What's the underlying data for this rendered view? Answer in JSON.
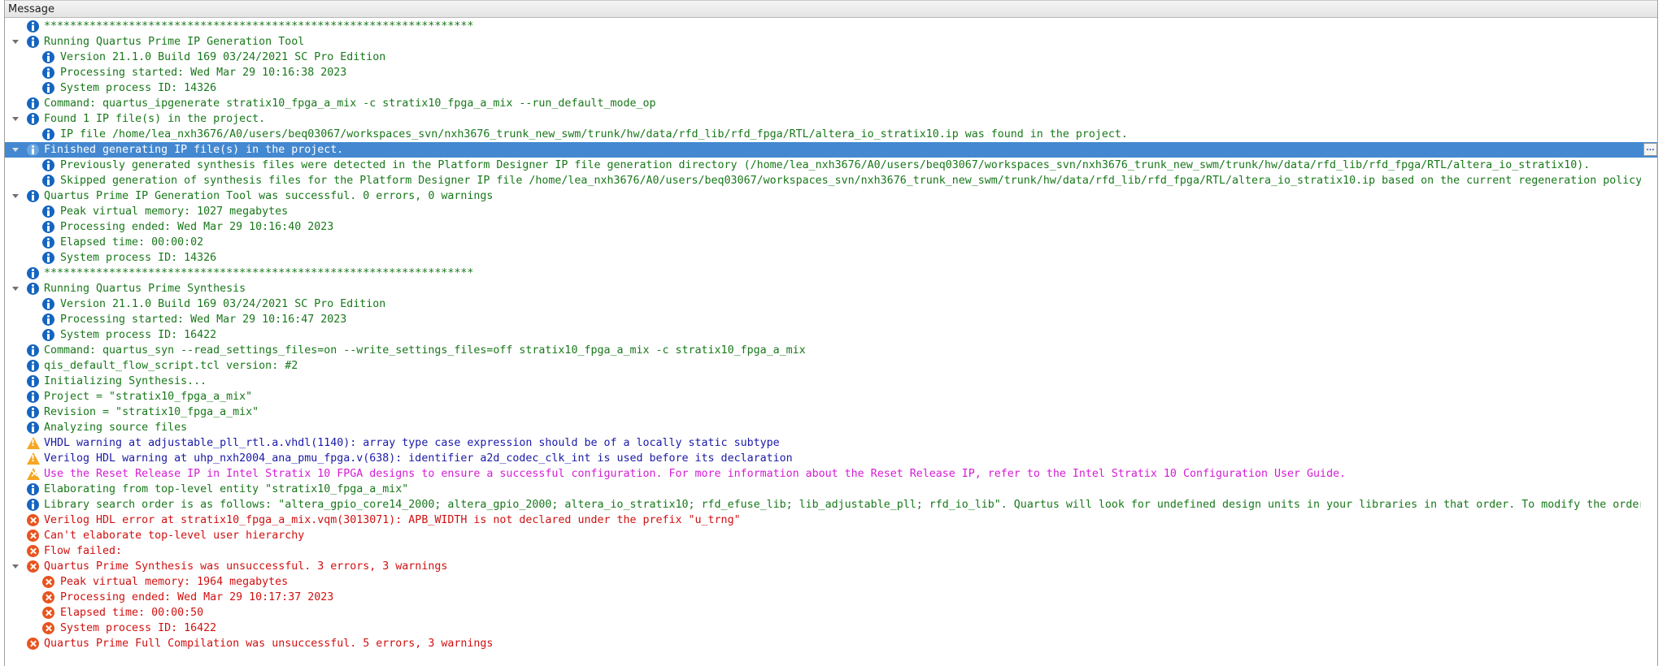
{
  "header": {
    "column": "Message"
  },
  "colors": {
    "info_text": "#18781a",
    "warning_text": "#1a1aa8",
    "critical_warning_text": "#d41cd4",
    "error_text": "#d01010",
    "selection": "#4388d0"
  },
  "rows": [
    {
      "level": 0,
      "expand": false,
      "type": "info",
      "text": "******************************************************************"
    },
    {
      "level": 0,
      "expand": true,
      "type": "info",
      "text": "Running Quartus Prime IP Generation Tool"
    },
    {
      "level": 1,
      "expand": false,
      "type": "info",
      "text": "Version 21.1.0 Build 169 03/24/2021 SC Pro Edition"
    },
    {
      "level": 1,
      "expand": false,
      "type": "info",
      "text": "Processing started: Wed Mar 29 10:16:38 2023"
    },
    {
      "level": 1,
      "expand": false,
      "type": "info",
      "text": "System process ID: 14326"
    },
    {
      "level": 0,
      "expand": false,
      "type": "info",
      "text": "Command: quartus_ipgenerate stratix10_fpga_a_mix -c stratix10_fpga_a_mix --run_default_mode_op"
    },
    {
      "level": 0,
      "expand": true,
      "type": "info",
      "text": "Found 1 IP file(s) in the project."
    },
    {
      "level": 1,
      "expand": false,
      "type": "info",
      "text": "IP file /home/lea_nxh3676/A0/users/beq03067/workspaces_svn/nxh3676_trunk_new_swm/trunk/hw/data/rfd_lib/rfd_fpga/RTL/altera_io_stratix10.ip was found in the project."
    },
    {
      "level": 0,
      "expand": true,
      "type": "info",
      "selected": true,
      "text": "Finished generating IP file(s) in the project.",
      "more": "..."
    },
    {
      "level": 1,
      "expand": false,
      "type": "info",
      "text": "Previously generated synthesis files were detected in the Platform Designer IP file generation directory (/home/lea_nxh3676/A0/users/beq03067/workspaces_svn/nxh3676_trunk_new_swm/trunk/hw/data/rfd_lib/rfd_fpga/RTL/altera_io_stratix10)."
    },
    {
      "level": 1,
      "expand": false,
      "type": "info",
      "text": "Skipped generation of synthesis files for the Platform Designer IP file /home/lea_nxh3676/A0/users/beq03067/workspaces_svn/nxh3676_trunk_new_swm/trunk/hw/data/rfd_lib/rfd_fpga/RTL/altera_io_stratix10.ip based on the current regeneration policy…"
    },
    {
      "level": 0,
      "expand": true,
      "type": "info",
      "text": "Quartus Prime IP Generation Tool was successful. 0 errors, 0 warnings"
    },
    {
      "level": 1,
      "expand": false,
      "type": "info",
      "text": "Peak virtual memory: 1027 megabytes"
    },
    {
      "level": 1,
      "expand": false,
      "type": "info",
      "text": "Processing ended: Wed Mar 29 10:16:40 2023"
    },
    {
      "level": 1,
      "expand": false,
      "type": "info",
      "text": "Elapsed time: 00:00:02"
    },
    {
      "level": 1,
      "expand": false,
      "type": "info",
      "text": "System process ID: 14326"
    },
    {
      "level": 0,
      "expand": false,
      "type": "info",
      "text": "******************************************************************"
    },
    {
      "level": 0,
      "expand": true,
      "type": "info",
      "text": "Running Quartus Prime Synthesis"
    },
    {
      "level": 1,
      "expand": false,
      "type": "info",
      "text": "Version 21.1.0 Build 169 03/24/2021 SC Pro Edition"
    },
    {
      "level": 1,
      "expand": false,
      "type": "info",
      "text": "Processing started: Wed Mar 29 10:16:47 2023"
    },
    {
      "level": 1,
      "expand": false,
      "type": "info",
      "text": "System process ID: 16422"
    },
    {
      "level": 0,
      "expand": false,
      "type": "info",
      "text": "Command: quartus_syn --read_settings_files=on --write_settings_files=off stratix10_fpga_a_mix -c stratix10_fpga_a_mix"
    },
    {
      "level": 0,
      "expand": false,
      "type": "info",
      "text": "qis_default_flow_script.tcl version: #2"
    },
    {
      "level": 0,
      "expand": false,
      "type": "info",
      "text": "Initializing Synthesis..."
    },
    {
      "level": 0,
      "expand": false,
      "type": "info",
      "text": "Project = \"stratix10_fpga_a_mix\""
    },
    {
      "level": 0,
      "expand": false,
      "type": "info",
      "text": "Revision = \"stratix10_fpga_a_mix\""
    },
    {
      "level": 0,
      "expand": false,
      "type": "info",
      "text": "Analyzing source files"
    },
    {
      "level": 0,
      "expand": false,
      "type": "warning",
      "text": "VHDL warning at adjustable_pll_rtl.a.vhdl(1140): array type case expression should be of a locally static subtype"
    },
    {
      "level": 0,
      "expand": false,
      "type": "warning",
      "text": "Verilog HDL warning at uhp_nxh2004_ana_pmu_fpga.v(638): identifier a2d_codec_clk_int is used before its declaration"
    },
    {
      "level": 0,
      "expand": false,
      "type": "critical",
      "text": "Use the Reset Release IP in Intel Stratix 10 FPGA designs to ensure a successful configuration. For more information about the Reset Release IP, refer to the Intel Stratix 10 Configuration User Guide."
    },
    {
      "level": 0,
      "expand": false,
      "type": "info",
      "text": "Elaborating from top-level entity \"stratix10_fpga_a_mix\""
    },
    {
      "level": 0,
      "expand": false,
      "type": "info",
      "text": "Library search order is as follows: \"altera_gpio_core14_2000; altera_gpio_2000; altera_io_stratix10; rfd_efuse_lib; lib_adjustable_pll; rfd_io_lib\". Quartus will look for undefined design units in your libraries in that order. To modify the order…"
    },
    {
      "level": 0,
      "expand": false,
      "type": "error",
      "text": "Verilog HDL error at stratix10_fpga_a_mix.vqm(3013071): APB_WIDTH is not declared under the prefix \"u_trng\""
    },
    {
      "level": 0,
      "expand": false,
      "type": "error",
      "text": "Can't elaborate top-level user hierarchy"
    },
    {
      "level": 0,
      "expand": false,
      "type": "error",
      "text": "Flow failed:"
    },
    {
      "level": 0,
      "expand": true,
      "type": "error",
      "text": "Quartus Prime Synthesis was unsuccessful. 3 errors, 3 warnings"
    },
    {
      "level": 1,
      "expand": false,
      "type": "error",
      "text": "Peak virtual memory: 1964 megabytes"
    },
    {
      "level": 1,
      "expand": false,
      "type": "error",
      "text": "Processing ended: Wed Mar 29 10:17:37 2023"
    },
    {
      "level": 1,
      "expand": false,
      "type": "error",
      "text": "Elapsed time: 00:00:50"
    },
    {
      "level": 1,
      "expand": false,
      "type": "error",
      "text": "System process ID: 16422"
    },
    {
      "level": 0,
      "expand": false,
      "type": "error",
      "text": "Quartus Prime Full Compilation was unsuccessful. 5 errors, 3 warnings"
    }
  ]
}
